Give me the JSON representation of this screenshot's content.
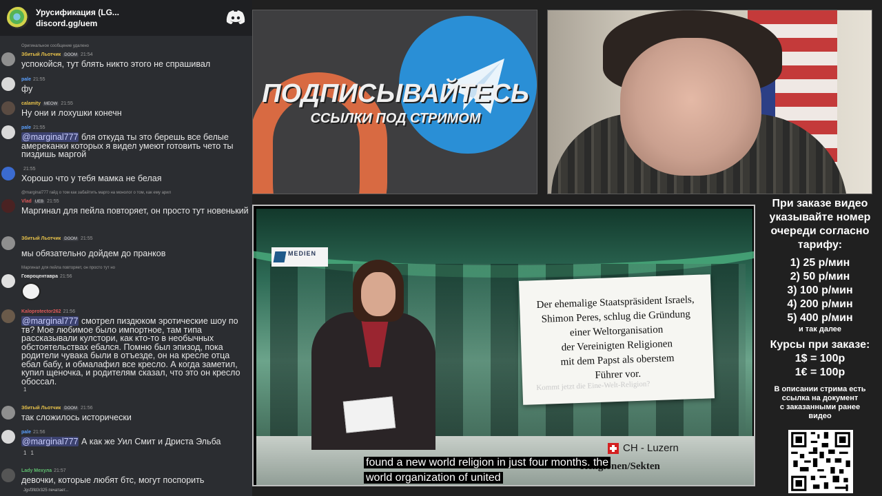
{
  "server": {
    "name": "Урусификация (LG...",
    "link": "discord.gg/uem",
    "discord_icon": "discord-icon"
  },
  "chat": [
    {
      "reply": "Оригинальное сообщение удалено",
      "user": "Збитый Льотчик",
      "user_color": "#e5c04a",
      "badge": "DOOM",
      "time": "21:54",
      "text": "успокойся, тут блять никто этого не спрашивал"
    },
    {
      "user": "pale",
      "user_color": "#5aa0ff",
      "time": "21:55",
      "text": "фу"
    },
    {
      "user": "calamity",
      "user_color": "#e5c04a",
      "badge": "MEOW",
      "time": "21:55",
      "text": "Ну они и лохушки конечн"
    },
    {
      "user": "pale",
      "user_color": "#5aa0ff",
      "time": "21:55",
      "mention": "@marginal777",
      "text": " бля откуда ты это берешь все белые амереканки которых я видел умеют готовить чето ты пиздишь маргой"
    },
    {
      "user": "",
      "user_color": "#e5c04a",
      "time": "21:55",
      "text": "Хорошо что у тебя мамка не белая"
    },
    {
      "reply": "@marginal777 гайд о том как забайтить марго на монолог о том, как ему арил",
      "user": "Vlad",
      "user_color": "#e05a5a",
      "badge": "UEB",
      "time": "21:55",
      "text": "Маргинал для пейла повторяет, он просто тут новенький"
    },
    {
      "user": "Збитый Льотчик",
      "user_color": "#e5c04a",
      "badge": "DOOM",
      "time": "21:55",
      "text": "мы обязательно дойдем до пранков"
    },
    {
      "reply": "Маргинал для пейла повторяет, он просто тут но",
      "user": "Говроцентавра",
      "user_color": "#e8e8e8",
      "time": "21:56",
      "text": ""
    },
    {
      "user": "Kaloprotector262",
      "user_color": "#e05a5a",
      "time": "21:56",
      "mention": "@marginal777",
      "text": " смотрел пиздюком эротические шоу по тв? Мое любимое было импортное, там типа рассказывали кулстори, как кто-то в необычных обстоятельствах ебался. Помню был эпизод, пока родители чувака были в отъезде, он на кресле отца ебал бабу, и обмалафил все кресло. А когда заметил, купил щеночка, и родителям сказал, что это он кресло обоссал."
    },
    {
      "user": "Збитый Льотчик",
      "user_color": "#e5c04a",
      "badge": "DOOM",
      "time": "21:56",
      "text": "так сложилось исторически"
    },
    {
      "user": "pale",
      "user_color": "#5aa0ff",
      "time": "21:56",
      "mention": "@marginal777",
      "text": " А как же Уил Смит и Дриста Эльба"
    },
    {
      "user": "Lady Meхула",
      "user_color": "#5fbf6f",
      "time": "21:57",
      "text": "девочки, которые любят бтс, могут поспорить"
    }
  ],
  "reactions_kalo": [
    "1"
  ],
  "reactions_pale": [
    "1",
    "1"
  ],
  "typing": "Jgsf3fd3r325 печатает...",
  "promo": {
    "title": "ПОДПИСЫВАЙТЕСЬ",
    "subtitle": "ССЫЛКИ ПОД СТРИМОМ",
    "p_color": "#d86a42",
    "tg_color": "#2a8fd6"
  },
  "info": {
    "intro": [
      "При заказе видео",
      "указывайте номер",
      "очереди согласно",
      "тарифу:"
    ],
    "tariffs": [
      "1) 25 р/мин",
      "2) 50 р/мин",
      "3) 100 р/мин",
      "4) 200 р/мин",
      "5) 400 р/мин"
    ],
    "more": "и так далее",
    "rates_title": "Курсы при заказе:",
    "rates": [
      "1$ = 100р",
      "1€ = 100р"
    ],
    "desc": [
      "В описании стрима есть",
      "ссылка на документ",
      "с заказанными ранее",
      "видео"
    ]
  },
  "video": {
    "logo": "MEDIEN",
    "card_lines": [
      "Der ehemalige Staatspräsident Israels,",
      "Shimon Peres, schlug die Gründung",
      "einer Weltorganisation",
      "der Vereinigten Religionen",
      "mit dem Papst als oberstem",
      "Führer vor."
    ],
    "card_faded": "Kommt jetzt die Eine-Welt-Religion?",
    "location": "CH - Luzern",
    "ticker": "Religionen/Sekten",
    "subtitle_lines": [
      "found a new world religion in just four months.  the",
      "world organization of united"
    ]
  }
}
